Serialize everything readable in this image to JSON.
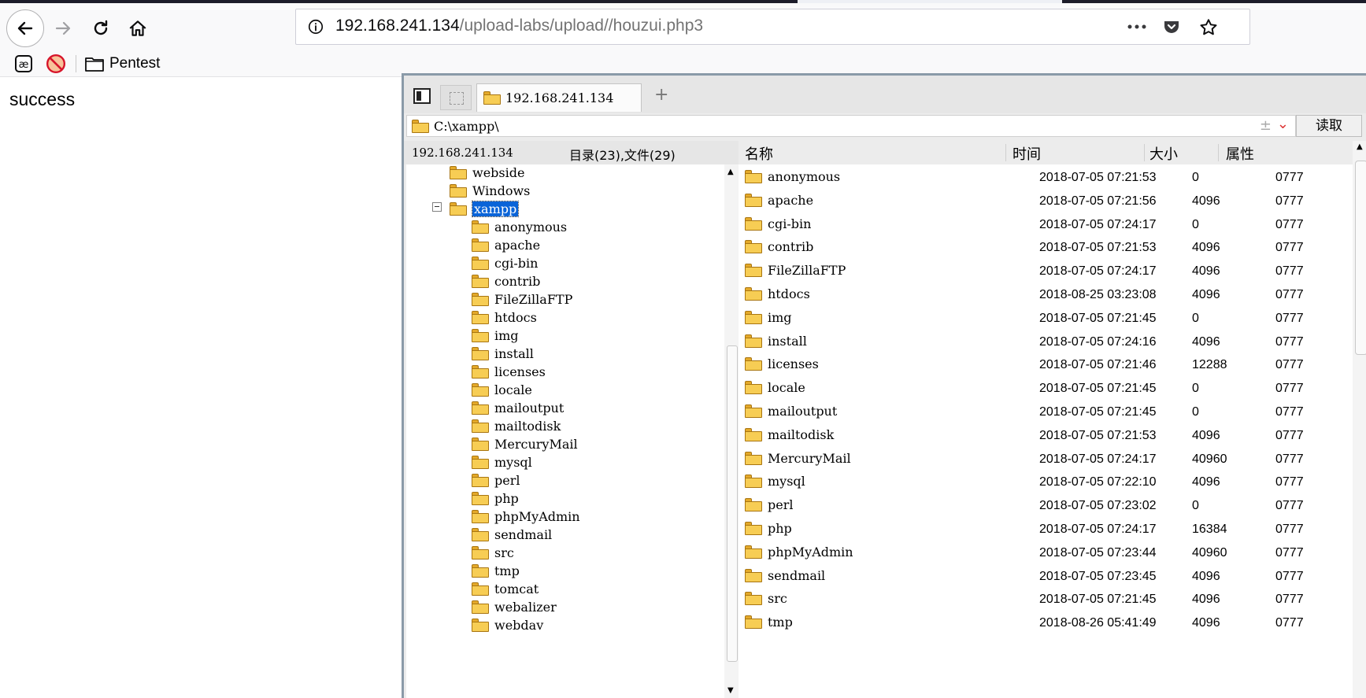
{
  "browser": {
    "url_host": "192.168.241.134",
    "url_path": "/upload-labs/upload//houzui.php3",
    "back_icon": "arrow-left-icon",
    "forward_icon": "arrow-right-icon",
    "reload_icon": "reload-icon",
    "home_icon": "home-icon",
    "page_actions_icon": "more-icon",
    "pocket_icon": "pocket-icon",
    "bookmark_star_icon": "star-icon"
  },
  "bookmarks": {
    "items": [
      {
        "label": "",
        "icon": "ae-icon"
      },
      {
        "label": "",
        "icon": "blocked-icon"
      },
      {
        "label": "Pentest",
        "icon": "folder-icon"
      }
    ]
  },
  "page": {
    "message": "success"
  },
  "file_manager": {
    "tab_label": "192.168.241.134",
    "add_tab": "+",
    "path": "C:\\xampp\\",
    "read_button": "读取",
    "host_label": "192.168.241.134",
    "summary": "目录(23),文件(29)",
    "columns": {
      "name": "名称",
      "time": "时间",
      "size": "大小",
      "attr": "属性"
    },
    "tree": {
      "above": [
        "webside",
        "Windows"
      ],
      "selected": "xampp",
      "children": [
        "anonymous",
        "apache",
        "cgi-bin",
        "contrib",
        "FileZillaFTP",
        "htdocs",
        "img",
        "install",
        "licenses",
        "locale",
        "mailoutput",
        "mailtodisk",
        "MercuryMail",
        "mysql",
        "perl",
        "php",
        "phpMyAdmin",
        "sendmail",
        "src",
        "tmp",
        "tomcat",
        "webalizer",
        "webdav"
      ]
    },
    "files": [
      {
        "name": "anonymous",
        "time": "2018-07-05 07:21:53",
        "size": "0",
        "attr": "0777"
      },
      {
        "name": "apache",
        "time": "2018-07-05 07:21:56",
        "size": "4096",
        "attr": "0777"
      },
      {
        "name": "cgi-bin",
        "time": "2018-07-05 07:24:17",
        "size": "0",
        "attr": "0777"
      },
      {
        "name": "contrib",
        "time": "2018-07-05 07:21:53",
        "size": "4096",
        "attr": "0777"
      },
      {
        "name": "FileZillaFTP",
        "time": "2018-07-05 07:24:17",
        "size": "4096",
        "attr": "0777"
      },
      {
        "name": "htdocs",
        "time": "2018-08-25 03:23:08",
        "size": "4096",
        "attr": "0777"
      },
      {
        "name": "img",
        "time": "2018-07-05 07:21:45",
        "size": "0",
        "attr": "0777"
      },
      {
        "name": "install",
        "time": "2018-07-05 07:24:16",
        "size": "4096",
        "attr": "0777"
      },
      {
        "name": "licenses",
        "time": "2018-07-05 07:21:46",
        "size": "12288",
        "attr": "0777"
      },
      {
        "name": "locale",
        "time": "2018-07-05 07:21:45",
        "size": "0",
        "attr": "0777"
      },
      {
        "name": "mailoutput",
        "time": "2018-07-05 07:21:45",
        "size": "0",
        "attr": "0777"
      },
      {
        "name": "mailtodisk",
        "time": "2018-07-05 07:21:53",
        "size": "4096",
        "attr": "0777"
      },
      {
        "name": "MercuryMail",
        "time": "2018-07-05 07:24:17",
        "size": "40960",
        "attr": "0777"
      },
      {
        "name": "mysql",
        "time": "2018-07-05 07:22:10",
        "size": "4096",
        "attr": "0777"
      },
      {
        "name": "perl",
        "time": "2018-07-05 07:23:02",
        "size": "0",
        "attr": "0777"
      },
      {
        "name": "php",
        "time": "2018-07-05 07:24:17",
        "size": "16384",
        "attr": "0777"
      },
      {
        "name": "phpMyAdmin",
        "time": "2018-07-05 07:23:44",
        "size": "40960",
        "attr": "0777"
      },
      {
        "name": "sendmail",
        "time": "2018-07-05 07:23:45",
        "size": "4096",
        "attr": "0777"
      },
      {
        "name": "src",
        "time": "2018-07-05 07:21:45",
        "size": "4096",
        "attr": "0777"
      },
      {
        "name": "tmp",
        "time": "2018-08-26 05:41:49",
        "size": "4096",
        "attr": "0777"
      }
    ]
  }
}
